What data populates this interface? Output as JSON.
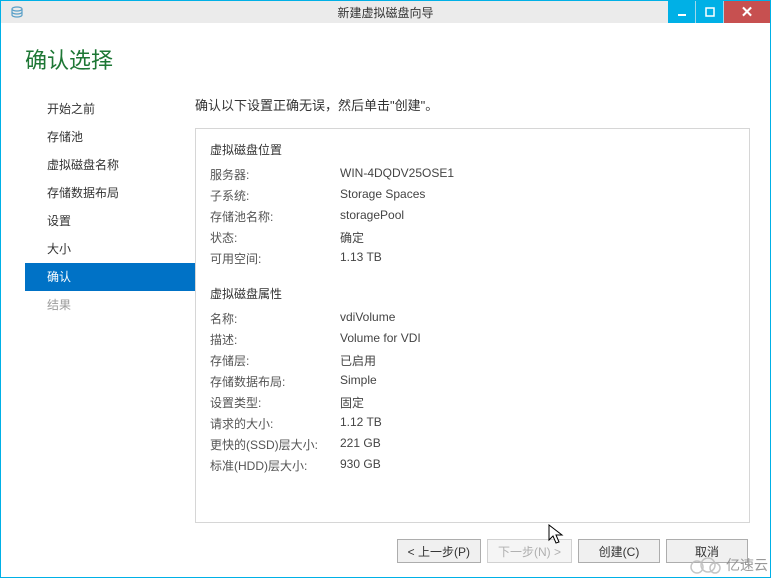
{
  "window": {
    "title": "新建虚拟磁盘向导"
  },
  "page": {
    "title": "确认选择",
    "instruction": "确认以下设置正确无误，然后单击\"创建\"。"
  },
  "sidebar": {
    "items": [
      {
        "label": "开始之前"
      },
      {
        "label": "存储池"
      },
      {
        "label": "虚拟磁盘名称"
      },
      {
        "label": "存储数据布局"
      },
      {
        "label": "设置"
      },
      {
        "label": "大小"
      },
      {
        "label": "确认"
      },
      {
        "label": "结果"
      }
    ]
  },
  "panel": {
    "group1_title": "虚拟磁盘位置",
    "group1_rows": {
      "server_label": "服务器:",
      "server_value": "WIN-4DQDV25OSE1",
      "subsystem_label": "子系统:",
      "subsystem_value": "Storage Spaces",
      "pool_label": "存储池名称:",
      "pool_value": "storagePool",
      "status_label": "状态:",
      "status_value": "确定",
      "free_label": "可用空间:",
      "free_value": "1.13 TB"
    },
    "group2_title": "虚拟磁盘属性",
    "group2_rows": {
      "name_label": "名称:",
      "name_value": "vdiVolume",
      "desc_label": "描述:",
      "desc_value": "Volume for VDI",
      "tier_label": "存储层:",
      "tier_value": "已启用",
      "layout_label": "存储数据布局:",
      "layout_value": "Simple",
      "settype_label": "设置类型:",
      "settype_value": "固定",
      "reqsize_label": "请求的大小:",
      "reqsize_value": "1.12 TB",
      "ssdtier_label": "更快的(SSD)层大小:",
      "ssdtier_value": "221 GB",
      "hddtier_label": "标准(HDD)层大小:",
      "hddtier_value": "930 GB"
    }
  },
  "footer": {
    "prev": "< 上一步(P)",
    "next": "下一步(N) >",
    "create": "创建(C)",
    "cancel": "取消"
  },
  "watermark": {
    "text": "亿速云"
  }
}
